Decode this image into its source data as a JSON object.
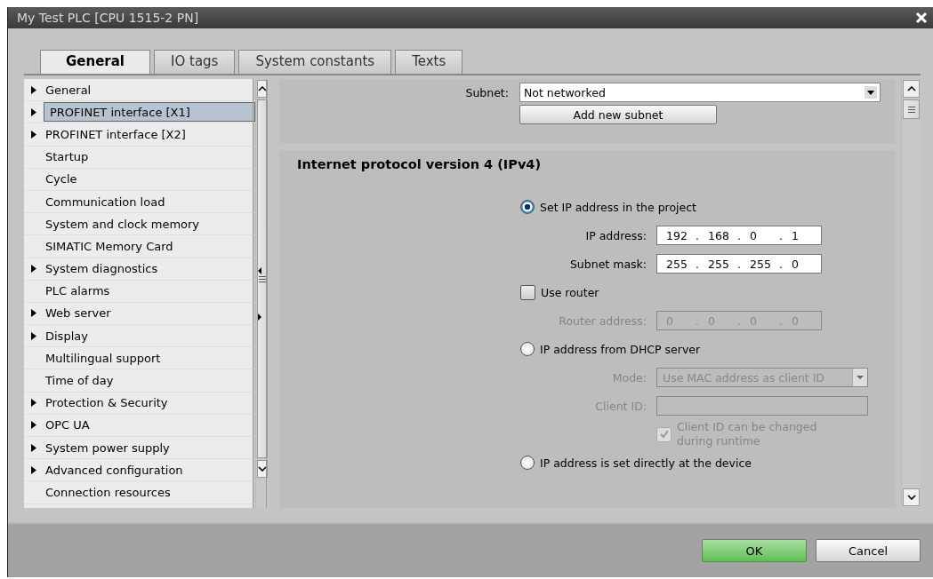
{
  "window": {
    "title": "My Test PLC [CPU 1515-2 PN]"
  },
  "tabs": [
    {
      "label": "General",
      "selected": true
    },
    {
      "label": "IO tags",
      "selected": false
    },
    {
      "label": "System constants",
      "selected": false
    },
    {
      "label": "Texts",
      "selected": false
    }
  ],
  "tree": {
    "items": [
      {
        "label": "General",
        "has_children": true,
        "selected": false
      },
      {
        "label": "PROFINET interface [X1]",
        "has_children": true,
        "selected": true
      },
      {
        "label": "PROFINET interface [X2]",
        "has_children": true,
        "selected": false
      },
      {
        "label": "Startup",
        "has_children": false,
        "selected": false
      },
      {
        "label": "Cycle",
        "has_children": false,
        "selected": false
      },
      {
        "label": "Communication load",
        "has_children": false,
        "selected": false
      },
      {
        "label": "System and clock memory",
        "has_children": false,
        "selected": false
      },
      {
        "label": "SIMATIC Memory Card",
        "has_children": false,
        "selected": false
      },
      {
        "label": "System diagnostics",
        "has_children": true,
        "selected": false
      },
      {
        "label": "PLC alarms",
        "has_children": false,
        "selected": false
      },
      {
        "label": "Web server",
        "has_children": true,
        "selected": false
      },
      {
        "label": "Display",
        "has_children": true,
        "selected": false
      },
      {
        "label": "Multilingual support",
        "has_children": false,
        "selected": false
      },
      {
        "label": "Time of day",
        "has_children": false,
        "selected": false
      },
      {
        "label": "Protection & Security",
        "has_children": true,
        "selected": false
      },
      {
        "label": "OPC UA",
        "has_children": true,
        "selected": false
      },
      {
        "label": "System power supply",
        "has_children": true,
        "selected": false
      },
      {
        "label": "Advanced configuration",
        "has_children": true,
        "selected": false
      },
      {
        "label": "Connection resources",
        "has_children": false,
        "selected": false
      }
    ]
  },
  "subnet": {
    "label": "Subnet:",
    "value": "Not networked",
    "button": "Add new subnet"
  },
  "ipv4": {
    "title": "Internet protocol version 4 (IPv4)",
    "rows": [
      {
        "kind": "radio",
        "label": "Set IP address in the project",
        "selected": true
      },
      {
        "kind": "address",
        "label": "IP address:",
        "octets": [
          "192",
          "168",
          "0",
          "1"
        ],
        "separator": ".",
        "disabled": false
      },
      {
        "kind": "address",
        "label": "Subnet mask:",
        "octets": [
          "255",
          "255",
          "255",
          "0"
        ],
        "separator": ".",
        "disabled": false
      },
      {
        "kind": "checkbox",
        "label": "Use router",
        "checked": false,
        "disabled": false
      },
      {
        "kind": "address",
        "label": "Router address:",
        "octets": [
          "0",
          "0",
          "0",
          "0"
        ],
        "separator": ".",
        "disabled": true
      },
      {
        "kind": "radio",
        "label": "IP address from DHCP server",
        "selected": false
      },
      {
        "kind": "select",
        "label": "Mode:",
        "value": "Use MAC address as client ID",
        "disabled": true
      },
      {
        "kind": "text",
        "label": "Client ID:",
        "disabled": true
      },
      {
        "kind": "subcheck",
        "label": "Client ID can be changed during runtime",
        "checked": true,
        "disabled": true
      },
      {
        "kind": "radio",
        "label": "IP address is set directly at the device",
        "selected": false
      }
    ]
  },
  "buttons": [
    {
      "label": "OK",
      "kind": "primary"
    },
    {
      "label": "Cancel",
      "kind": "normal"
    }
  ]
}
